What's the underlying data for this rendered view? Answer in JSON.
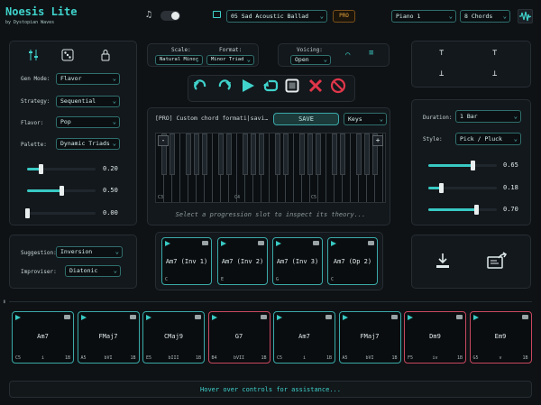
{
  "app": {
    "title": "Noesis Lite",
    "subtitle": "by Dystopian Waves"
  },
  "header": {
    "progression": "05 Sad Acoustic Ballad",
    "pro_badge": "PRO",
    "instrument": "Piano 1",
    "chord_count": "8 Chords"
  },
  "left": {
    "gen_mode_label": "Gen Mode:",
    "gen_mode": "Flavor",
    "strategy_label": "Strategy:",
    "strategy": "Sequential",
    "flavor_label": "Flavor:",
    "flavor": "Pop",
    "palette_label": "Palette:",
    "palette": "Dynamic Triads",
    "sliders": [
      {
        "value": 0.2,
        "display": "0.20"
      },
      {
        "value": 0.5,
        "display": "0.50"
      },
      {
        "value": 0.0,
        "display": "0.00"
      }
    ]
  },
  "scale": {
    "label": "Scale:",
    "value": "Natural Minor",
    "format_label": "Format:",
    "format_value": "Minor Triad"
  },
  "voicing": {
    "label": "Voicing:",
    "value": "Open"
  },
  "editor": {
    "chord_field": "[PRO] Custom chord formati|savi…",
    "save_label": "SAVE",
    "view": "Keys",
    "minus": "-",
    "plus": "+",
    "octave_labels": [
      "C3",
      "C4",
      "C5"
    ],
    "hint": "Select a progression slot to inspect its theory..."
  },
  "right": {
    "duration_label": "Duration:",
    "duration": "1 Bar",
    "style_label": "Style:",
    "style": "Pick / Pluck",
    "sliders": [
      {
        "value": 0.65,
        "display": "0.65"
      },
      {
        "value": 0.18,
        "display": "0.18"
      },
      {
        "value": 0.7,
        "display": "0.70"
      }
    ]
  },
  "suggest": {
    "suggestion_label": "Suggestion:",
    "suggestion": "Inversion",
    "improviser_label": "Improviser:",
    "improviser": "Diatonic"
  },
  "inversions": [
    {
      "name": "Am7 (Inv 1)",
      "note": "C"
    },
    {
      "name": "Am7 (Inv 2)",
      "note": "E"
    },
    {
      "name": "Am7 (Inv 3)",
      "note": "G"
    },
    {
      "name": "Am7 (Dp 2)",
      "note": "C"
    }
  ],
  "progression": [
    {
      "name": "Am7",
      "root": "C5",
      "degree": "i",
      "len": "1B",
      "color": "teal"
    },
    {
      "name": "FMaj7",
      "root": "A5",
      "degree": "bVI",
      "len": "1B",
      "color": "teal"
    },
    {
      "name": "CMaj9",
      "root": "E5",
      "degree": "bIII",
      "len": "1B",
      "color": "teal"
    },
    {
      "name": "G7",
      "root": "B4",
      "degree": "bVII",
      "len": "1B",
      "color": "red"
    },
    {
      "name": "Am7",
      "root": "C5",
      "degree": "i",
      "len": "1B",
      "color": "teal"
    },
    {
      "name": "FMaj7",
      "root": "A5",
      "degree": "bVI",
      "len": "1B",
      "color": "teal"
    },
    {
      "name": "Dm9",
      "root": "F5",
      "degree": "iv",
      "len": "1B",
      "color": "red"
    },
    {
      "name": "Em9",
      "root": "G5",
      "degree": "v",
      "len": "1B",
      "color": "red"
    }
  ],
  "status": "Hover over controls for assistance...",
  "colors": {
    "accent": "#38c9c3",
    "alert": "#c8485f",
    "background": "#0e1215"
  }
}
